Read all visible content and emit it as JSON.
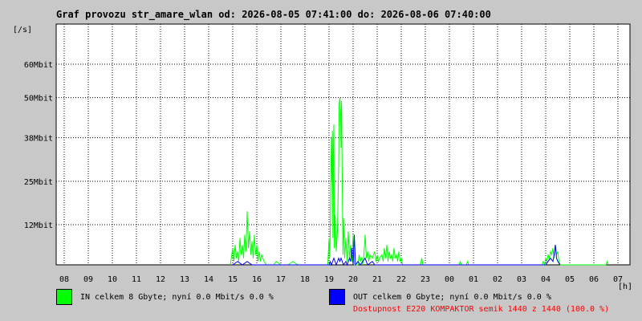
{
  "title": "Graf provozu str_amare_wlan od: 2026-08-05 07:41:00 do: 2026-08-06 07:40:00",
  "legend": {
    "in_label": "IN celkem 8 Gbyte; nyní   0.0 Mbit/s 0.0 %",
    "in_color": "#00ff00",
    "out_label": "OUT celkem 0 Gbyte; nyní   0.0 Mbit/s 0.0 %",
    "out_color": "#0000ff"
  },
  "availability": {
    "text": "Dostupnost E220 KOMPAKTOR semik 1440 z 1440 (100.0 %)",
    "color": "#ff0000"
  },
  "chart_data": {
    "type": "line",
    "ylabel": "[/s]",
    "xlabel": "[h]",
    "ylim": [
      0,
      72
    ],
    "y_ticks": [
      {
        "value": 12,
        "label": "12Mbit"
      },
      {
        "value": 25,
        "label": "25Mbit"
      },
      {
        "value": 38,
        "label": "38Mbit"
      },
      {
        "value": 50,
        "label": "50Mbit"
      },
      {
        "value": 60,
        "label": "60Mbit"
      }
    ],
    "x_tick_labels": [
      "08",
      "09",
      "10",
      "11",
      "12",
      "13",
      "14",
      "15",
      "16",
      "17",
      "18",
      "19",
      "20",
      "21",
      "22",
      "23",
      "00",
      "01",
      "02",
      "03",
      "04",
      "05",
      "06",
      "07"
    ],
    "x_range_hours": [
      0,
      24
    ],
    "grid": true,
    "series": [
      {
        "name": "IN",
        "color": "#00ff00",
        "points": [
          [
            6.9,
            0
          ],
          [
            7.0,
            5
          ],
          [
            7.05,
            1
          ],
          [
            7.1,
            6
          ],
          [
            7.15,
            2
          ],
          [
            7.2,
            4
          ],
          [
            7.25,
            1
          ],
          [
            7.3,
            8
          ],
          [
            7.35,
            3
          ],
          [
            7.4,
            6
          ],
          [
            7.45,
            2
          ],
          [
            7.5,
            9
          ],
          [
            7.55,
            4
          ],
          [
            7.6,
            16
          ],
          [
            7.65,
            5
          ],
          [
            7.7,
            10
          ],
          [
            7.75,
            3
          ],
          [
            7.8,
            7
          ],
          [
            7.85,
            2
          ],
          [
            7.9,
            9
          ],
          [
            7.95,
            3
          ],
          [
            8.0,
            6
          ],
          [
            8.05,
            1
          ],
          [
            8.1,
            4
          ],
          [
            8.15,
            1
          ],
          [
            8.2,
            3
          ],
          [
            8.3,
            1
          ],
          [
            8.4,
            0
          ],
          [
            8.7,
            0
          ],
          [
            8.8,
            1
          ],
          [
            9.0,
            0
          ],
          [
            9.3,
            0
          ],
          [
            9.5,
            1
          ],
          [
            9.7,
            0
          ],
          [
            10.95,
            0
          ],
          [
            11.0,
            8
          ],
          [
            11.03,
            2
          ],
          [
            11.06,
            14
          ],
          [
            11.08,
            30
          ],
          [
            11.1,
            38
          ],
          [
            11.12,
            25
          ],
          [
            11.14,
            40
          ],
          [
            11.16,
            8
          ],
          [
            11.18,
            34
          ],
          [
            11.2,
            42
          ],
          [
            11.22,
            5
          ],
          [
            11.25,
            15
          ],
          [
            11.3,
            4
          ],
          [
            11.35,
            10
          ],
          [
            11.4,
            30
          ],
          [
            11.42,
            48
          ],
          [
            11.45,
            50
          ],
          [
            11.48,
            46
          ],
          [
            11.5,
            35
          ],
          [
            11.52,
            49
          ],
          [
            11.55,
            24
          ],
          [
            11.58,
            3
          ],
          [
            11.6,
            14
          ],
          [
            11.65,
            2
          ],
          [
            11.7,
            8
          ],
          [
            11.75,
            1
          ],
          [
            11.8,
            10
          ],
          [
            11.85,
            2
          ],
          [
            11.9,
            6
          ],
          [
            11.95,
            1
          ],
          [
            12.0,
            9
          ],
          [
            12.05,
            0
          ],
          [
            12.2,
            0
          ],
          [
            12.25,
            3
          ],
          [
            12.3,
            1
          ],
          [
            12.35,
            2
          ],
          [
            12.4,
            0
          ],
          [
            12.45,
            3
          ],
          [
            12.5,
            9
          ],
          [
            12.55,
            2
          ],
          [
            12.6,
            4
          ],
          [
            12.65,
            1
          ],
          [
            12.7,
            3
          ],
          [
            12.8,
            2
          ],
          [
            12.9,
            4
          ],
          [
            12.95,
            1
          ],
          [
            13.0,
            3
          ],
          [
            13.05,
            1
          ],
          [
            13.1,
            2
          ],
          [
            13.2,
            3
          ],
          [
            13.25,
            1
          ],
          [
            13.3,
            5
          ],
          [
            13.35,
            2
          ],
          [
            13.4,
            6
          ],
          [
            13.45,
            1
          ],
          [
            13.5,
            4
          ],
          [
            13.55,
            2
          ],
          [
            13.6,
            3
          ],
          [
            13.65,
            1
          ],
          [
            13.7,
            5
          ],
          [
            13.75,
            2
          ],
          [
            13.8,
            3
          ],
          [
            13.85,
            1
          ],
          [
            13.9,
            4
          ],
          [
            13.95,
            1
          ],
          [
            14.0,
            2
          ],
          [
            14.05,
            0
          ],
          [
            14.8,
            0
          ],
          [
            14.85,
            2
          ],
          [
            14.9,
            0
          ],
          [
            16.4,
            0
          ],
          [
            16.45,
            1
          ],
          [
            16.5,
            0
          ],
          [
            16.7,
            0
          ],
          [
            16.75,
            1
          ],
          [
            16.8,
            0
          ],
          [
            19.85,
            0
          ],
          [
            19.9,
            1
          ],
          [
            19.95,
            0
          ],
          [
            20.0,
            2
          ],
          [
            20.05,
            1
          ],
          [
            20.1,
            3
          ],
          [
            20.15,
            2
          ],
          [
            20.2,
            4
          ],
          [
            20.25,
            3
          ],
          [
            20.3,
            5
          ],
          [
            20.35,
            2
          ],
          [
            20.4,
            6
          ],
          [
            20.45,
            3
          ],
          [
            20.5,
            4
          ],
          [
            20.55,
            1
          ],
          [
            20.6,
            0
          ],
          [
            22.5,
            0
          ],
          [
            22.55,
            1
          ],
          [
            22.6,
            0
          ]
        ]
      },
      {
        "name": "OUT",
        "color": "#0000ff",
        "points": [
          [
            7.0,
            0
          ],
          [
            7.2,
            1
          ],
          [
            7.4,
            0
          ],
          [
            7.6,
            1
          ],
          [
            7.8,
            0
          ],
          [
            11.0,
            0
          ],
          [
            11.05,
            1
          ],
          [
            11.1,
            0
          ],
          [
            11.2,
            2
          ],
          [
            11.25,
            1
          ],
          [
            11.3,
            0
          ],
          [
            11.4,
            2
          ],
          [
            11.45,
            1
          ],
          [
            11.5,
            2
          ],
          [
            11.6,
            0
          ],
          [
            11.7,
            1
          ],
          [
            11.75,
            0
          ],
          [
            11.85,
            2
          ],
          [
            11.9,
            1
          ],
          [
            11.95,
            5
          ],
          [
            12.0,
            0
          ],
          [
            12.05,
            9
          ],
          [
            12.1,
            0
          ],
          [
            12.2,
            1
          ],
          [
            12.3,
            0
          ],
          [
            12.5,
            2
          ],
          [
            12.6,
            0
          ],
          [
            12.8,
            1
          ],
          [
            12.9,
            0
          ],
          [
            20.0,
            0
          ],
          [
            20.1,
            1
          ],
          [
            20.2,
            2
          ],
          [
            20.3,
            1
          ],
          [
            20.35,
            3
          ],
          [
            20.4,
            6
          ],
          [
            20.45,
            2
          ],
          [
            20.5,
            1
          ],
          [
            20.6,
            0
          ]
        ]
      }
    ]
  }
}
